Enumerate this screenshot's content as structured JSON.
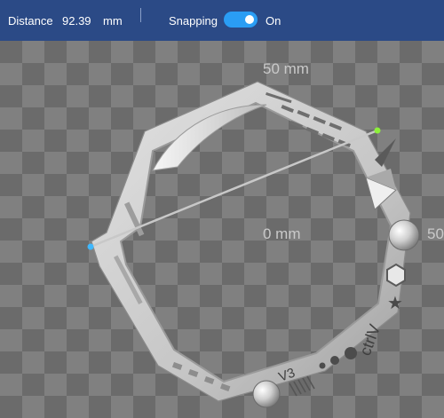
{
  "toolbar": {
    "distance_label": "Distance",
    "distance_value": "92.39",
    "distance_unit": "mm",
    "snapping_label": "Snapping",
    "snapping_state": "On",
    "snapping_enabled": true
  },
  "viewport": {
    "scale_labels": [
      "50 mm",
      "0 mm",
      "50"
    ],
    "model_engraving_version": "V3",
    "model_engraving_brand": "ctrlV"
  },
  "colors": {
    "toolbar_bg": "#2b4a86",
    "accent": "#2a9df4",
    "measure_start": "#3fb8ff",
    "measure_end": "#8df03a"
  }
}
